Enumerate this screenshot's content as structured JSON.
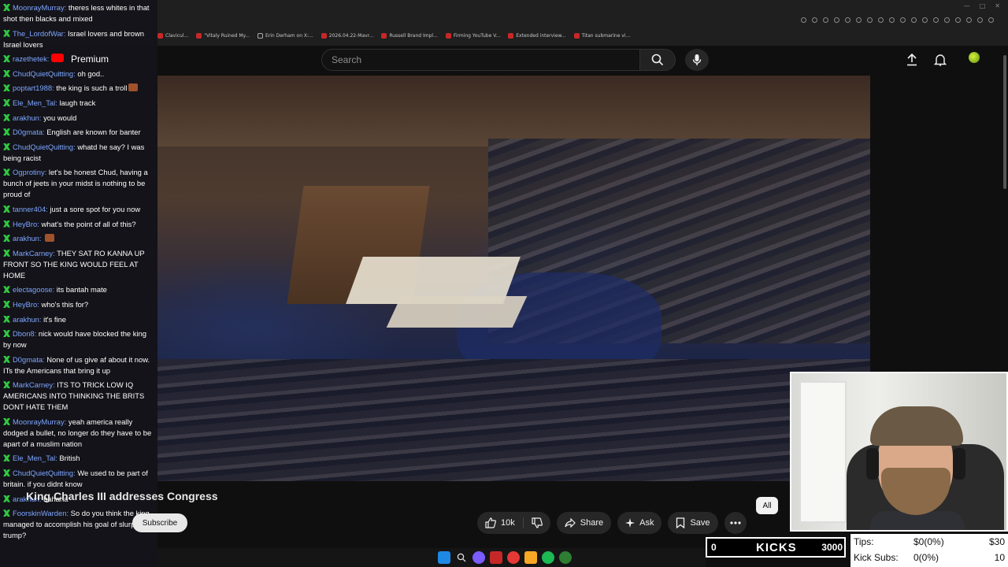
{
  "browser": {
    "bookmarks": [
      "Clavicul...",
      "\"Vitaly Ruined My...",
      "Erin Derham on X:...",
      "2026.04.22-Mavr...",
      "Russell Brand Impl...",
      "Firming YouTube V...",
      "Extended interview...",
      "Titan submarine vi..."
    ]
  },
  "header": {
    "search_placeholder": "Search"
  },
  "chat": [
    {
      "user": "MoonrayMurray",
      "text": "theres less whites in that shot then blacks and mixed"
    },
    {
      "user": "The_LordofWar",
      "text": "Israel lovers and brown Israel lovers"
    },
    {
      "user": "razethetek",
      "text": "Premium"
    },
    {
      "user": "ChudQuietQuitting",
      "text": "oh god.."
    },
    {
      "user": "poptart1988",
      "text": "the king is such a troll"
    },
    {
      "user": "Ele_Men_Tal",
      "text": "laugh track"
    },
    {
      "user": "arakhun",
      "text": "you would"
    },
    {
      "user": "D0gmata",
      "text": "English are known for banter"
    },
    {
      "user": "ChudQuietQuitting",
      "text": "whatd he say? I was being racist"
    },
    {
      "user": "Ogprotiny",
      "text": "let's be honest Chud, having a bunch of jeets in your midst is nothing to be proud of"
    },
    {
      "user": "tanner404",
      "text": "just a sore spot for you now"
    },
    {
      "user": "HeyBro",
      "text": "what's the point of all of this?"
    },
    {
      "user": "arakhun",
      "text": ""
    },
    {
      "user": "MarkCarney",
      "text": "THEY SAT RO KANNA UP FRONT SO THE KING WOULD FEEL AT HOME"
    },
    {
      "user": "electagoose",
      "text": "its bantah mate"
    },
    {
      "user": "HeyBro",
      "text": "who's this for?"
    },
    {
      "user": "arakhun",
      "text": "it's fine"
    },
    {
      "user": "Dbon8",
      "text": "nick would have blocked the king by now"
    },
    {
      "user": "D0gmata",
      "text": "None of us give af about it now. ITs the Americans that bring it up"
    },
    {
      "user": "MarkCarney",
      "text": "ITS TO TRICK LOW IQ AMERICANS INTO THINKING THE BRITS DONT HATE THEM"
    },
    {
      "user": "MoonrayMurray",
      "text": "yeah america really dodged a bullet, no longer do they have to be apart of a muslim nation"
    },
    {
      "user": "Ele_Men_Tal",
      "text": "British"
    },
    {
      "user": "ChudQuietQuitting",
      "text": "We used to be part of britain. if you didnt know"
    },
    {
      "user": "arakhun",
      "text": "hahaha"
    },
    {
      "user": "FoorskinWarden",
      "text": "So do you think the king managed to accomplish his goal of slurping trump?"
    }
  ],
  "video": {
    "title": "King Charles III addresses Congress",
    "subscribe_label": "Subscribe",
    "like_count": "10k",
    "share_label": "Share",
    "ask_label": "Ask",
    "save_label": "Save",
    "chip_all": "All"
  },
  "kicks": {
    "current": "0",
    "label": "KICKS",
    "goal": "3000",
    "progress": 0
  },
  "tips": {
    "tips_label": "Tips:",
    "tips_value": "$0(0%)",
    "tips_goal": "$30",
    "subs_label": "Kick Subs:",
    "subs_value": "0(0%)",
    "subs_goal": "10"
  },
  "colors": {
    "chat_user": "#7ea6ff",
    "chat_check": "#2ecc40",
    "bg": "#0f0f0f"
  }
}
